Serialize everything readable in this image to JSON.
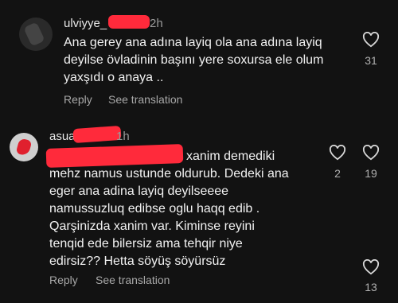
{
  "comments": [
    {
      "username": "ulviyye_",
      "time": "2h",
      "text": "Ana gerey ana adına layiq ola ana adına layiq\ndeyilse övladinin başını yere soxursa ele olum\nyaxşıdı o anaya ..",
      "likes": "31",
      "reply_label": "Reply",
      "translate_label": "See translation"
    },
    {
      "username": "asua",
      "time": "1h",
      "text": "xanim demediki\nmehz namus ustunde oldurub. Dedeki ana\neger ana adina layiq deyilseeee\nnamussuzluq edibse oglu haqq edib .\nQarşinizda xanim var. Kiminse reyini\ntenqid ede bilersiz ama tehqir niye\nedirsiz?? Hetta söyüş söyürsüz",
      "reply_count": "2",
      "likes": "19",
      "reply_label": "Reply",
      "translate_label": "See translation"
    }
  ],
  "extra_likes": "13",
  "colors": {
    "background": "#121212",
    "redaction": "#ff2a3b",
    "muted": "#a8a8a8"
  },
  "icons": {
    "heart": "heart-outline-icon"
  }
}
